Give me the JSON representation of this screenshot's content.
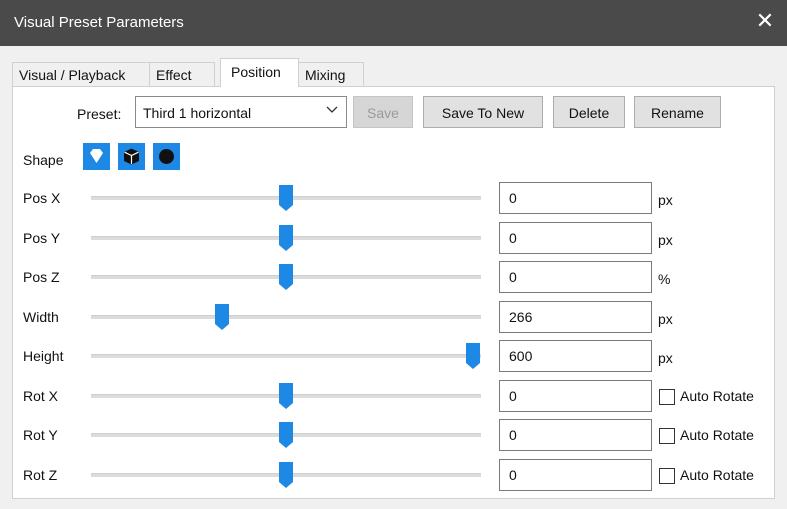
{
  "window": {
    "title": "Visual Preset Parameters",
    "close_glyph": "✕"
  },
  "tabs": [
    {
      "label": "Visual / Playback",
      "active": false
    },
    {
      "label": "Effect",
      "active": false
    },
    {
      "label": "Position",
      "active": true
    },
    {
      "label": "Mixing",
      "active": false
    }
  ],
  "preset": {
    "label": "Preset:",
    "selected": "Third 1 horizontal",
    "save_label": "Save",
    "save_enabled": false,
    "save_to_new_label": "Save To New",
    "delete_label": "Delete",
    "rename_label": "Rename"
  },
  "shape": {
    "label": "Shape",
    "options": [
      "diamond-icon",
      "cube-icon",
      "sphere-icon"
    ],
    "accent": "#1e88e5"
  },
  "rows": [
    {
      "label": "Pos X",
      "value": "0",
      "unit": "px",
      "slider_fraction": 0.5
    },
    {
      "label": "Pos Y",
      "value": "0",
      "unit": "px",
      "slider_fraction": 0.5
    },
    {
      "label": "Pos Z",
      "value": "0",
      "unit": "%",
      "slider_fraction": 0.5
    },
    {
      "label": "Width",
      "value": "266",
      "unit": "px",
      "slider_fraction": 0.33
    },
    {
      "label": "Height",
      "value": "600",
      "unit": "px",
      "slider_fraction": 1.0
    },
    {
      "label": "Rot X",
      "value": "0",
      "auto_rotate_label": "Auto Rotate",
      "auto_rotate": false,
      "slider_fraction": 0.5
    },
    {
      "label": "Rot Y",
      "value": "0",
      "auto_rotate_label": "Auto Rotate",
      "auto_rotate": false,
      "slider_fraction": 0.5
    },
    {
      "label": "Rot Z",
      "value": "0",
      "auto_rotate_label": "Auto Rotate",
      "auto_rotate": false,
      "slider_fraction": 0.5
    }
  ],
  "colors": {
    "titlebar": "#4a4a4a",
    "accent": "#1e88e5",
    "panel": "#f0f0f0"
  }
}
